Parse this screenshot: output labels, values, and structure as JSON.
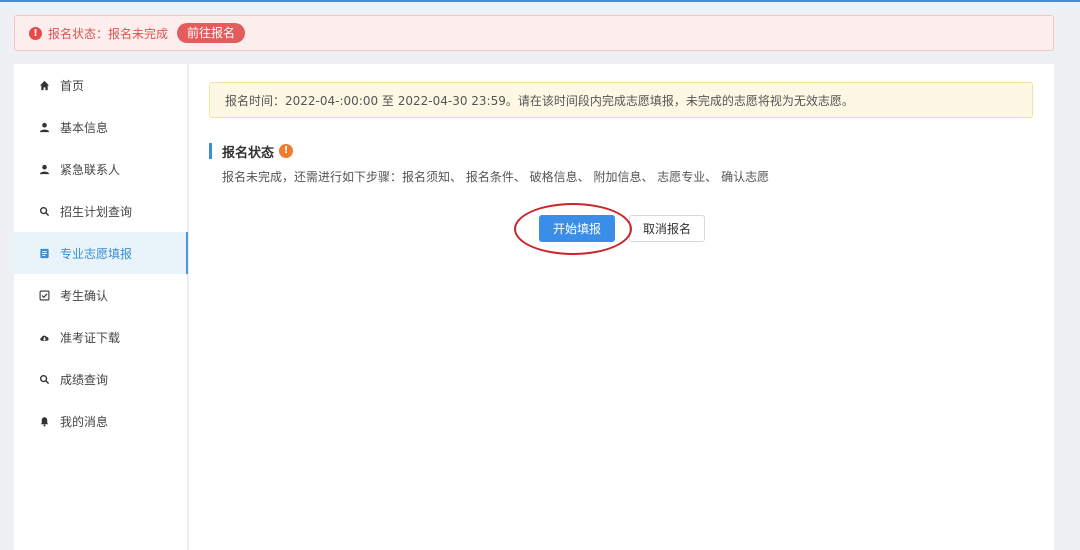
{
  "alert": {
    "icon": "exclamation-circle-icon",
    "text": "报名状态：报名未完成",
    "button_label": "前往报名"
  },
  "sidebar": {
    "items": [
      {
        "label": "首页",
        "icon": "home-icon"
      },
      {
        "label": "基本信息",
        "icon": "user-icon"
      },
      {
        "label": "紧急联系人",
        "icon": "user-icon"
      },
      {
        "label": "招生计划查询",
        "icon": "search-icon"
      },
      {
        "label": "专业志愿填报",
        "icon": "document-icon",
        "active": true
      },
      {
        "label": "考生确认",
        "icon": "checkbox-icon"
      },
      {
        "label": "准考证下载",
        "icon": "cloud-download-icon"
      },
      {
        "label": "成绩查询",
        "icon": "search-icon"
      },
      {
        "label": "我的消息",
        "icon": "bell-icon"
      }
    ]
  },
  "main": {
    "notice": "报名时间：2022-04-:00:00 至 2022-04-30 23:59。请在该时间段内完成志愿填报，未完成的志愿将视为无效志愿。",
    "section_title": "报名状态",
    "steps_text": "报名未完成，还需进行如下步骤：报名须知、 报名条件、 破格信息、 附加信息、 志愿专业、 确认志愿",
    "start_button": "开始填报",
    "cancel_button": "取消报名"
  },
  "colors": {
    "accent": "#3a8ee8",
    "alert": "#e45d5d",
    "warning": "#f07b2f",
    "highlight_ring": "#c8262a"
  }
}
